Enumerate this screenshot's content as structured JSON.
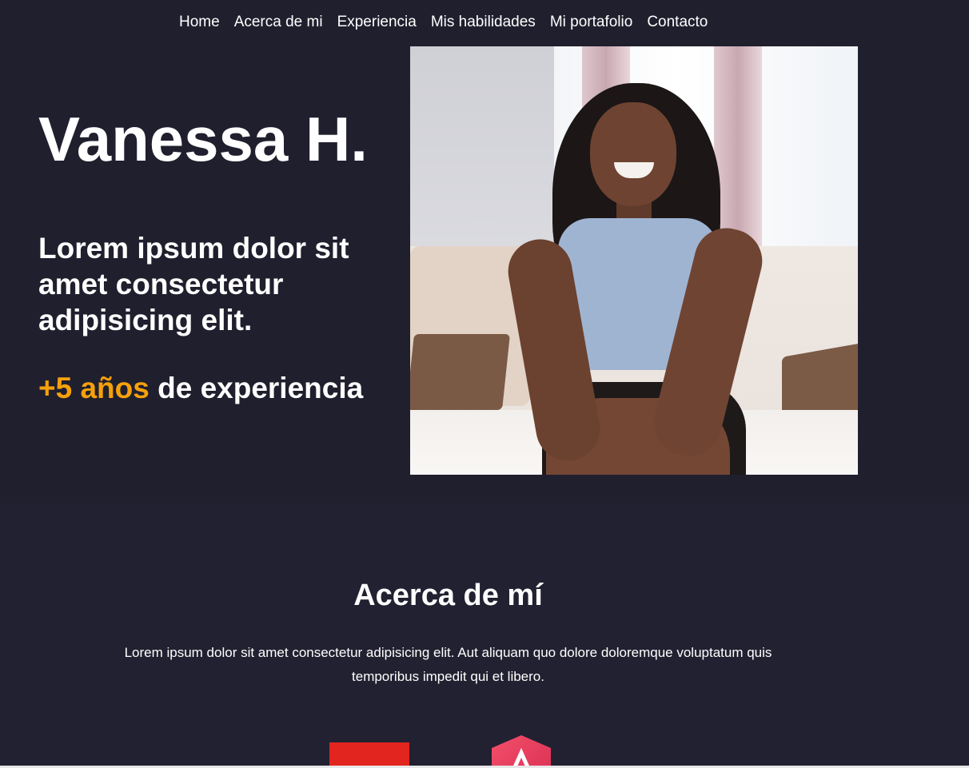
{
  "nav": {
    "items": [
      "Home",
      "Acerca de mi",
      "Experiencia",
      "Mis habilidades",
      "Mi portafolio",
      "Contacto"
    ]
  },
  "hero": {
    "name": "Vanessa H.",
    "tagline": "Lorem ipsum dolor sit amet consectetur adipisicing elit.",
    "experience_highlight": "+5 años",
    "experience_rest": " de experiencia",
    "photo_alt": "Retrato de Vanessa H. sonriendo sentada en un sofá"
  },
  "about": {
    "title": "Acerca de mí",
    "text": "Lorem ipsum dolor sit amet consectetur adipisicing elit. Aut aliquam quo dolore doloremque voluptatum quis temporibus impedit qui et libero."
  },
  "skills": {
    "icons": [
      "red-block-icon",
      "hexagon-a-icon"
    ]
  },
  "colors": {
    "background": "#201f2d",
    "accent": "#f5a10c",
    "text": "#ffffff",
    "skill_red": "#e2251f",
    "hex_pink": "#e8365d"
  }
}
